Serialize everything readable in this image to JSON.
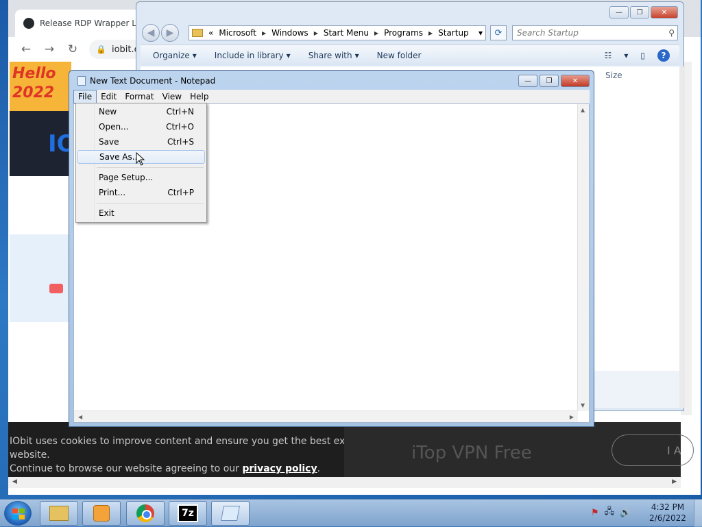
{
  "chrome": {
    "tab_title": "Release RDP Wrapper Libr",
    "url": "iobit.co",
    "nav_back": "←",
    "nav_forward": "→",
    "nav_reload": "↻",
    "lock_icon": "🔒",
    "banner_hello": "Hello",
    "banner_year": "2022",
    "logo_text": "IO",
    "cookie_text_1": "IObit uses cookies to improve content and ensure you get the best experience on our website.",
    "cookie_text_2": "Continue to browse our website agreeing to our ",
    "cookie_link": "privacy policy",
    "cookie_period": ".",
    "vpn_title": "iTop VPN Free",
    "accept_label": "I A"
  },
  "explorer": {
    "caption": {
      "minimize": "—",
      "maximize": "❐",
      "close": "✕"
    },
    "back_icon": "◀",
    "forward_icon": "▶",
    "breadcrumb": [
      "«",
      "Microsoft",
      "Windows",
      "Start Menu",
      "Programs",
      "Startup"
    ],
    "dropdown_arrow": "▾",
    "refresh_icon": "⟳",
    "search_placeholder": "Search Startup",
    "search_icon": "⚲",
    "commands": [
      "Organize",
      "Include in library",
      "Share with",
      "New folder"
    ],
    "view_icon": "☷",
    "preview_icon": "▯",
    "help_icon": "?",
    "column_size": "Size"
  },
  "notepad": {
    "title": "New Text Document - Notepad",
    "caption": {
      "minimize": "—",
      "maximize": "❐",
      "close": "✕"
    },
    "menus": [
      "File",
      "Edit",
      "Format",
      "View",
      "Help"
    ],
    "active_menu": "File",
    "file_menu": [
      {
        "label": "New",
        "shortcut": "Ctrl+N"
      },
      {
        "label": "Open...",
        "shortcut": "Ctrl+O"
      },
      {
        "label": "Save",
        "shortcut": "Ctrl+S"
      },
      {
        "label": "Save As...",
        "shortcut": ""
      },
      {
        "label": "Page Setup...",
        "shortcut": ""
      },
      {
        "label": "Print...",
        "shortcut": "Ctrl+P"
      },
      {
        "label": "Exit",
        "shortcut": ""
      }
    ],
    "hovered_item": "Save As..."
  },
  "taskbar": {
    "items": [
      "Windows Explorer",
      "Windows Media Player",
      "Google Chrome",
      "7-Zip",
      "Notepad"
    ],
    "sevenzip_label": "7z",
    "tray_icons": [
      "action-center-flag",
      "network",
      "volume"
    ],
    "tray_flag": "⚑",
    "tray_network": "🖧",
    "tray_volume": "🔊",
    "time": "4:32 PM",
    "date": "2/6/2022"
  }
}
